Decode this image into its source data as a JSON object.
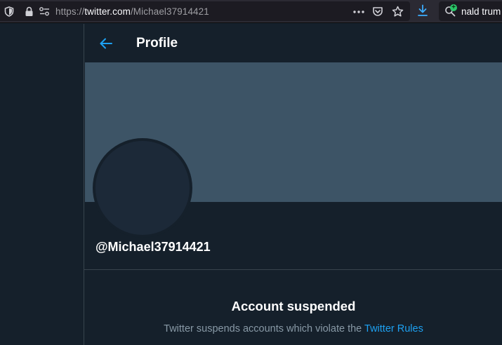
{
  "browser": {
    "url_prefix": "https://",
    "url_host": "twitter.com",
    "url_path": "/Michael37914421",
    "search_text": "nald trum"
  },
  "icons": {
    "tracking": "shield-icon",
    "lock": "lock-icon",
    "permissions": "permissions-icon",
    "more": "more-icon",
    "pocket": "pocket-icon",
    "bookmark": "star-icon",
    "downloads": "download-icon",
    "search": "search-icon",
    "back": "back-arrow-icon"
  },
  "header": {
    "title": "Profile"
  },
  "profile": {
    "handle": "@Michael37914421"
  },
  "suspension": {
    "title": "Account suspended",
    "description": "Twitter suspends accounts which violate the ",
    "link_label": "Twitter Rules"
  },
  "colors": {
    "background": "#15202b",
    "banner": "#3d5466",
    "accent": "#1da1f2",
    "muted_text": "#8899a6",
    "divider": "#38444d"
  }
}
